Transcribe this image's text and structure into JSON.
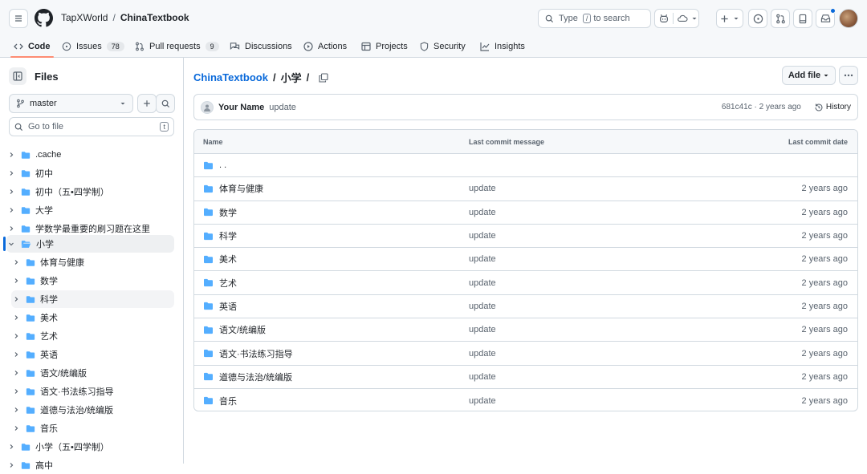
{
  "header": {
    "owner": "TapXWorld",
    "separator": "/",
    "repo": "ChinaTextbook",
    "search_type": "Type",
    "search_kbd": "/",
    "search_rest": "to search"
  },
  "tabs": [
    {
      "label": "Code",
      "count": ""
    },
    {
      "label": "Issues",
      "count": "78"
    },
    {
      "label": "Pull requests",
      "count": "9"
    },
    {
      "label": "Discussions",
      "count": ""
    },
    {
      "label": "Actions",
      "count": ""
    },
    {
      "label": "Projects",
      "count": ""
    },
    {
      "label": "Security",
      "count": ""
    },
    {
      "label": "Insights",
      "count": ""
    }
  ],
  "sidebar": {
    "title": "Files",
    "branch": "master",
    "goto_placeholder": "Go to file",
    "goto_kbd": "t",
    "tree": [
      {
        "label": ".cache"
      },
      {
        "label": "初中"
      },
      {
        "label": "初中（五•四学制）"
      },
      {
        "label": "大学"
      },
      {
        "label": "学数学最重要的刷习题在这里"
      },
      {
        "label": "小学"
      },
      {
        "label": "体育与健康"
      },
      {
        "label": "数学"
      },
      {
        "label": "科学"
      },
      {
        "label": "美术"
      },
      {
        "label": "艺术"
      },
      {
        "label": "英语"
      },
      {
        "label": "语文/统编版"
      },
      {
        "label": "语文·书法练习指导"
      },
      {
        "label": "道德与法治/统编版"
      },
      {
        "label": "音乐"
      },
      {
        "label": "小学（五•四学制）"
      },
      {
        "label": "高中"
      }
    ]
  },
  "main": {
    "path_root": "ChinaTextbook",
    "path_sep": "/",
    "path_current": "小学",
    "path_trail": "/",
    "add_file": "Add file",
    "commit": {
      "author": "Your Name",
      "message": "update",
      "meta": "681c41c · 2 years ago",
      "history": "History"
    },
    "columns": {
      "name": "Name",
      "message": "Last commit message",
      "date": "Last commit date"
    },
    "rows": [
      {
        "name": ". .",
        "message": "",
        "date": ""
      },
      {
        "name": "体育与健康",
        "message": "update",
        "date": "2 years ago"
      },
      {
        "name": "数学",
        "message": "update",
        "date": "2 years ago"
      },
      {
        "name": "科学",
        "message": "update",
        "date": "2 years ago"
      },
      {
        "name": "美术",
        "message": "update",
        "date": "2 years ago"
      },
      {
        "name": "艺术",
        "message": "update",
        "date": "2 years ago"
      },
      {
        "name": "英语",
        "message": "update",
        "date": "2 years ago"
      },
      {
        "name": "语文/统编版",
        "message": "update",
        "date": "2 years ago"
      },
      {
        "name": "语文·书法练习指导",
        "message": "update",
        "date": "2 years ago"
      },
      {
        "name": "道德与法治/统编版",
        "message": "update",
        "date": "2 years ago"
      },
      {
        "name": "音乐",
        "message": "update",
        "date": "2 years ago"
      }
    ]
  },
  "colors": {
    "accent": "#0969da",
    "folder": "#54aeff",
    "tab_underline": "#fd8c73"
  }
}
